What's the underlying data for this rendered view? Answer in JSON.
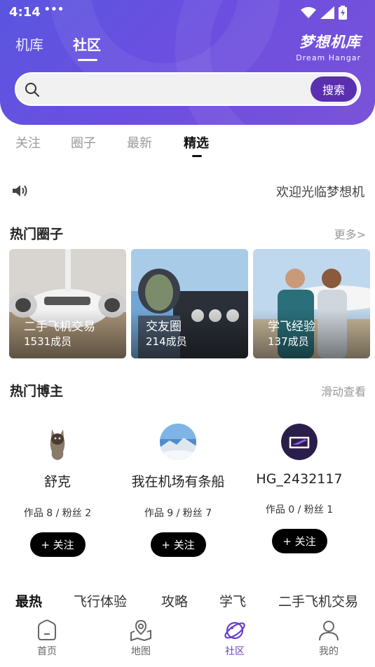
{
  "status": {
    "time": "4:14",
    "dots": "•••"
  },
  "header": {
    "tabs": [
      {
        "label": "机库"
      },
      {
        "label": "社区"
      }
    ],
    "active_tab": "社区",
    "brand_cn": "梦想机库",
    "brand_en": "Dream Hangar"
  },
  "search": {
    "placeholder": "",
    "button_label": "搜索"
  },
  "sub_tabs": [
    {
      "label": "关注"
    },
    {
      "label": "圈子"
    },
    {
      "label": "最新"
    },
    {
      "label": "精选"
    }
  ],
  "notice": {
    "text": "欢迎光临梦想机库"
  },
  "hot_circles": {
    "title": "热门圈子",
    "more": "更多>",
    "items": [
      {
        "name": "二手飞机交易",
        "members": "1531成员"
      },
      {
        "name": "交友圈",
        "members": "214成员"
      },
      {
        "name": "学飞经验",
        "members": "137成员"
      }
    ]
  },
  "hot_bloggers": {
    "title": "热门博主",
    "hint": "滑动查看",
    "items": [
      {
        "name": "舒克",
        "stats": "作品 8 / 粉丝 2",
        "follow": "+ 关注"
      },
      {
        "name": "我在机场有条船",
        "stats": "作品 9 / 粉丝 7",
        "follow": "+ 关注"
      },
      {
        "name": "HG_2432117",
        "stats": "作品 0 / 粉丝 1",
        "follow": "+ 关注"
      }
    ]
  },
  "categories": [
    {
      "label": "最热"
    },
    {
      "label": "飞行体验"
    },
    {
      "label": "攻略"
    },
    {
      "label": "学飞"
    },
    {
      "label": "二手飞机交易"
    }
  ],
  "bottom_nav": [
    {
      "label": "首页"
    },
    {
      "label": "地图"
    },
    {
      "label": "社区"
    },
    {
      "label": "我的"
    }
  ],
  "colors": {
    "accent": "#6a3fc8",
    "header_start": "#5a55e0",
    "header_end": "#7a52d8",
    "search_button": "#5a2fb0"
  }
}
